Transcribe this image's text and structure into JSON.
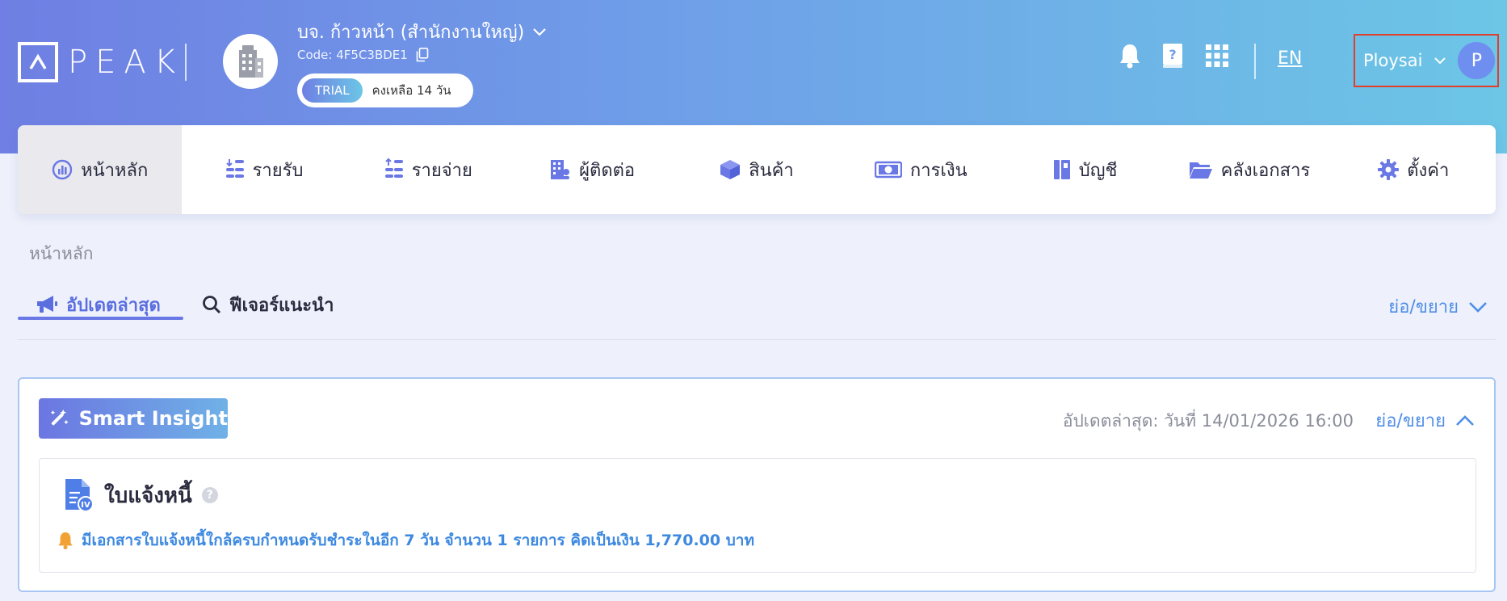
{
  "brand": {
    "logo_text": "PEAK"
  },
  "company": {
    "name": "บจ. ก้าวหน้า (สำนักงานใหญ่)",
    "code_label": "Code: 4F5C3BDE1",
    "trial_badge": "TRIAL",
    "trial_remaining": "คงเหลือ 14 วัน"
  },
  "header": {
    "language": "EN",
    "user_name": "Ploysai",
    "user_initial": "P"
  },
  "nav": {
    "items": [
      {
        "label": "หน้าหลัก",
        "icon": "dashboard-icon"
      },
      {
        "label": "รายรับ",
        "icon": "income-icon"
      },
      {
        "label": "รายจ่าย",
        "icon": "expense-icon"
      },
      {
        "label": "ผู้ติดต่อ",
        "icon": "contacts-icon"
      },
      {
        "label": "สินค้า",
        "icon": "product-box-icon"
      },
      {
        "label": "การเงิน",
        "icon": "money-icon"
      },
      {
        "label": "บัญชี",
        "icon": "ledger-book-icon"
      },
      {
        "label": "คลังเอกสาร",
        "icon": "folder-icon"
      },
      {
        "label": "ตั้งค่า",
        "icon": "gear-icon"
      }
    ]
  },
  "page": {
    "breadcrumb": "หน้าหลัก",
    "tabs": [
      {
        "label": "อัปเดตล่าสุด",
        "icon": "megaphone-icon"
      },
      {
        "label": "ฟีเจอร์แนะนำ",
        "icon": "search-icon"
      }
    ],
    "collapse_label": "ย่อ/ขยาย"
  },
  "insight": {
    "badge": "Smart Insight",
    "updated": "อัปเดตล่าสุด: วันที่ 14/01/2026 16:00",
    "collapse_label": "ย่อ/ขยาย",
    "invoice_title": "ใบแจ้งหนี้",
    "help": "?",
    "message": "มีเอกสารใบแจ้งหนี้ใกล้ครบกำหนดรับชำระในอีก 7 วัน จำนวน 1 รายการ คิดเป็นเงิน 1,770.00 บาท"
  },
  "colors": {
    "accent": "#6a78e6",
    "link": "#4f8ee8",
    "alert": "#f2a234",
    "highlight_border": "#e0402b"
  }
}
